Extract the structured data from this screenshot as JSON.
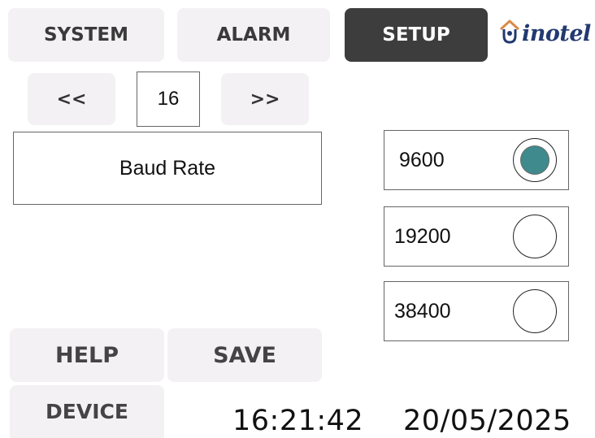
{
  "tabs": [
    {
      "label": "SYSTEM",
      "active": false
    },
    {
      "label": "ALARM",
      "active": false
    },
    {
      "label": "SETUP",
      "active": true
    }
  ],
  "logo": {
    "text": "inotel",
    "icon": "house-icon"
  },
  "pager": {
    "prev_label": "<<",
    "page": "16",
    "next_label": ">>"
  },
  "parameter": {
    "label": "Baud Rate"
  },
  "options": [
    {
      "label": "9600",
      "selected": true
    },
    {
      "label": "19200",
      "selected": false
    },
    {
      "label": "38400",
      "selected": false
    }
  ],
  "actions": {
    "help_label": "HELP",
    "save_label": "SAVE",
    "device_label": "DEVICE"
  },
  "status": {
    "time": "16:21:42",
    "date": "20/05/2025"
  },
  "colors": {
    "active_tab": "#3d3d3d",
    "button_bg": "#f4f1f4",
    "radio_selected": "#3e8a8c",
    "logo": "#223a70"
  }
}
